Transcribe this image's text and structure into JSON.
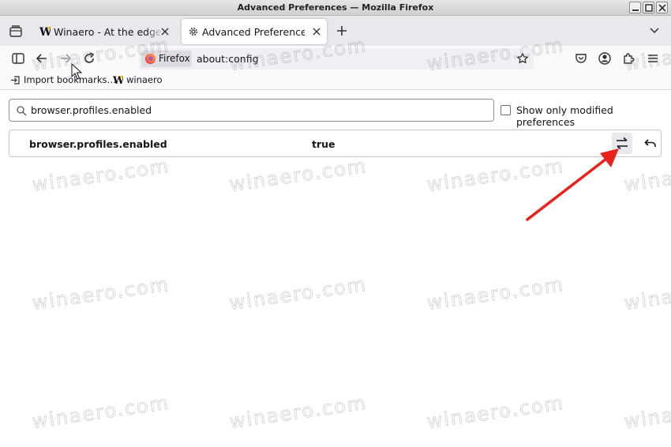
{
  "window": {
    "title": "Advanced Preferences — Mozilla Firefox"
  },
  "tabs": [
    {
      "label": "Winaero - At the edge of tweaking",
      "favicon": "winaero-w-icon",
      "active": false
    },
    {
      "label": "Advanced Preferences",
      "favicon": "gear-icon",
      "active": true
    }
  ],
  "urlbar": {
    "identity_label": "Firefox",
    "url": "about:config"
  },
  "bookmarks": [
    {
      "label": "Import bookmarks…",
      "icon": "import-icon"
    },
    {
      "label": "winaero",
      "icon": "winaero-w-icon"
    }
  ],
  "config": {
    "search_value": "browser.profiles.enabled",
    "show_modified_label": "Show only modified preferences",
    "show_modified_checked": false,
    "preferences": [
      {
        "name": "browser.profiles.enabled",
        "value": "true"
      }
    ]
  },
  "watermark": "winaero.com",
  "colors": {
    "arrow": "#e8211c",
    "active_tab_bg": "#ffffff",
    "tabstrip_bg": "#e8e8ed"
  }
}
